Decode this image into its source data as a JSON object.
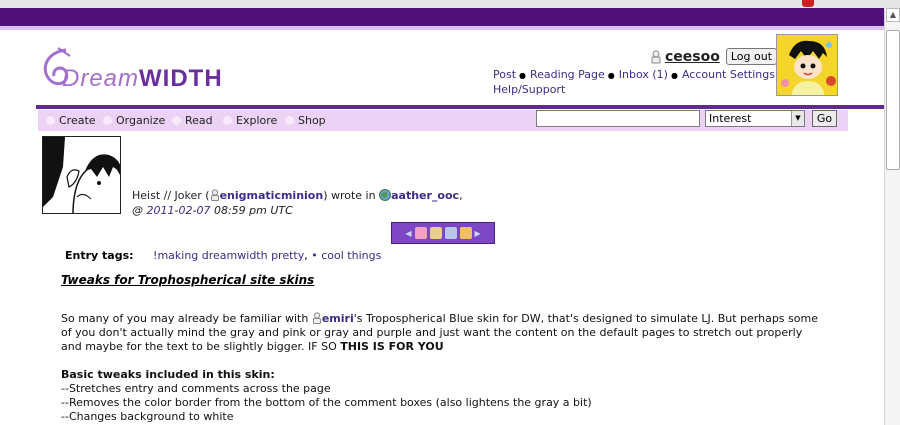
{
  "colors": {
    "topbar": "#50107a",
    "purple_rule": "#5f2b90",
    "nav_bg": "#ecd3f5",
    "link": "#3a2d8a",
    "toolbar": "#7c46c4"
  },
  "logo": {
    "dream": "Dream",
    "width": "WIDTH",
    "icon": "dreamwidth-logo"
  },
  "header": {
    "username": "ceesoo",
    "logout_label": "Log out",
    "links": [
      "Post",
      "Reading Page",
      "Inbox (1)",
      "Account Settings",
      "Help/Support"
    ]
  },
  "nav": {
    "items": [
      "Create",
      "Organize",
      "Read",
      "Explore",
      "Shop"
    ],
    "search_value": "",
    "select_value": "Interest",
    "go_label": "Go"
  },
  "entry": {
    "icon_title": "Heist // Joker",
    "open_paren": "(",
    "poster": "enigmaticminion",
    "wrote_in": ") wrote in",
    "community": "aather_ooc",
    "comma": ",",
    "at": "@",
    "date_year": "2011",
    "date_month": "02",
    "date_day": "07",
    "time": "08:59 pm UTC",
    "tags_label": "Entry tags:",
    "tags": [
      "!making dreamwidth pretty",
      "• cool things"
    ],
    "subject": "Tweaks for Trophospherical site skins",
    "para1_a": "So many of you may already be familiar with",
    "para1_user": "emiri",
    "para1_b": "'s",
    "para1_link": "Tropospherical Blue",
    "para1_c": "skin for DW, that's designed to simulate LJ. But perhaps some of you don't actually mind the gray and pink or gray and purple and just want the content on the default pages to stretch out properly and maybe for the text to be slightly bigger. IF SO",
    "para1_bold": "THIS IS FOR YOU",
    "list_title": "Basic tweaks included in this skin:",
    "list": [
      "--Stretches entry and comments across the page",
      "--Removes the color border from the bottom of the comment boxes (also lightens the gray a bit)",
      "--Changes background to white"
    ]
  }
}
